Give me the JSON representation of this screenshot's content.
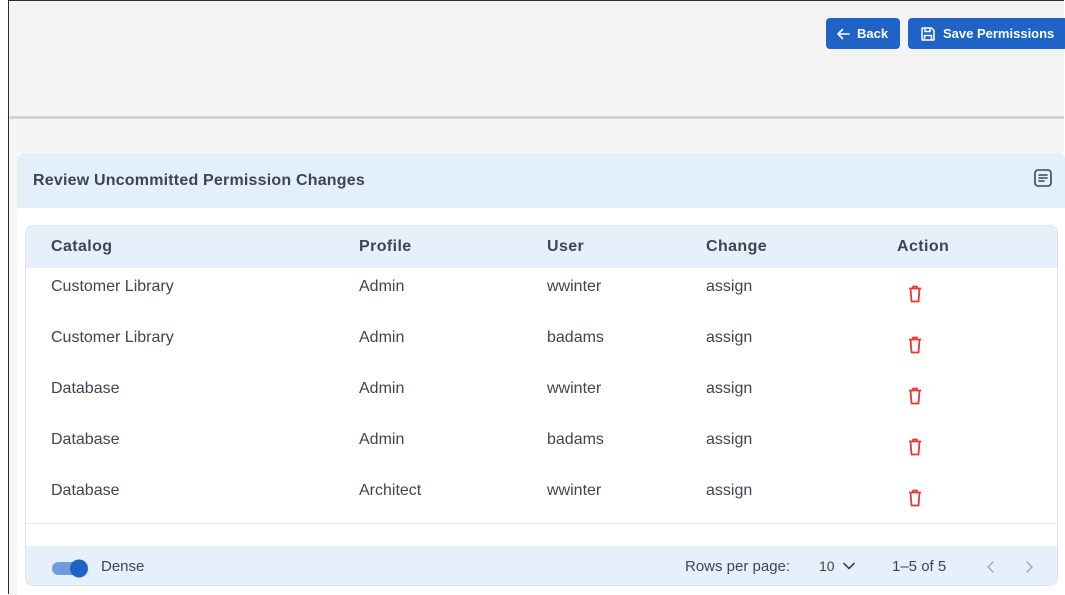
{
  "toolbar": {
    "back_label": "Back",
    "save_label": "Save Permissions"
  },
  "panel": {
    "title": "Review Uncommitted Permission Changes",
    "filter_icon": "filter-list-icon"
  },
  "table": {
    "columns": [
      "Catalog",
      "Profile",
      "User",
      "Change",
      "Action"
    ],
    "rows": [
      {
        "catalog": "Customer Library",
        "profile": "Admin",
        "user": "wwinter",
        "change": "assign"
      },
      {
        "catalog": "Customer Library",
        "profile": "Admin",
        "user": "badams",
        "change": "assign"
      },
      {
        "catalog": "Database",
        "profile": "Admin",
        "user": "wwinter",
        "change": "assign"
      },
      {
        "catalog": "Database",
        "profile": "Admin",
        "user": "badams",
        "change": "assign"
      },
      {
        "catalog": "Database",
        "profile": "Architect",
        "user": "wwinter",
        "change": "assign"
      }
    ],
    "action_icon": "trash-icon"
  },
  "footer": {
    "dense_label": "Dense",
    "dense_on": true,
    "rows_per_page_label": "Rows per page:",
    "rows_per_page_value": "10",
    "range": "1–5 of 5"
  },
  "colors": {
    "primary": "#1f63c7",
    "header_bg": "#e3effb",
    "delete": "#e53935"
  }
}
